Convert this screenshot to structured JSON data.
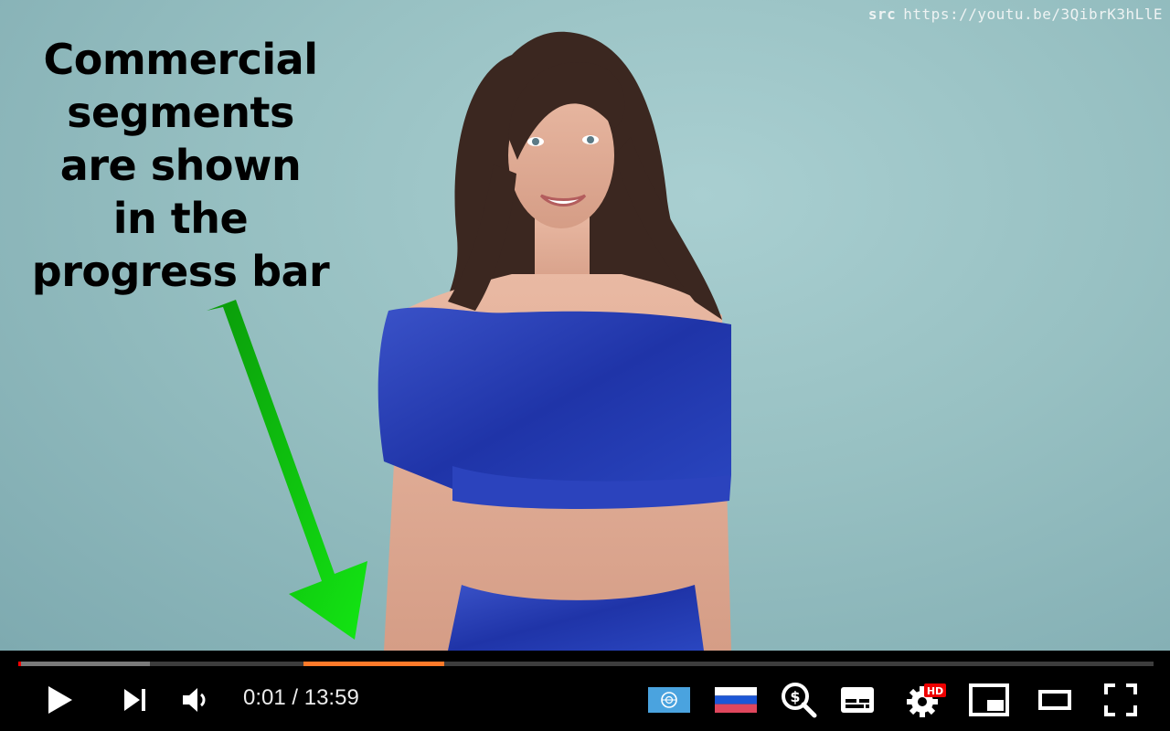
{
  "video": {
    "src_key": "src",
    "src_url": "https://youtu.be/3QibrK3hLlE",
    "annotation_lines": [
      "Commercial",
      "segments",
      "are shown",
      "in the",
      "progress bar"
    ]
  },
  "player": {
    "current_time": "0:01",
    "separator": "/",
    "duration": "13:59",
    "played_fraction": 0.001,
    "buffered_fraction": 0.116,
    "sponsor_segment": {
      "start_fraction": 0.251,
      "end_fraction": 0.375
    },
    "colors": {
      "played": "#ff0000",
      "segment": "#ff7a2a",
      "buffer": "#7a7a7a",
      "track": "#3d3d3d"
    },
    "hd_badge": "HD",
    "controls": [
      "play-icon",
      "next-icon",
      "volume-icon",
      "un-flag-icon",
      "ru-flag-icon",
      "dollar-search-icon",
      "subtitles-icon",
      "settings-icon",
      "miniplayer-icon",
      "theater-icon",
      "fullscreen-icon"
    ]
  }
}
